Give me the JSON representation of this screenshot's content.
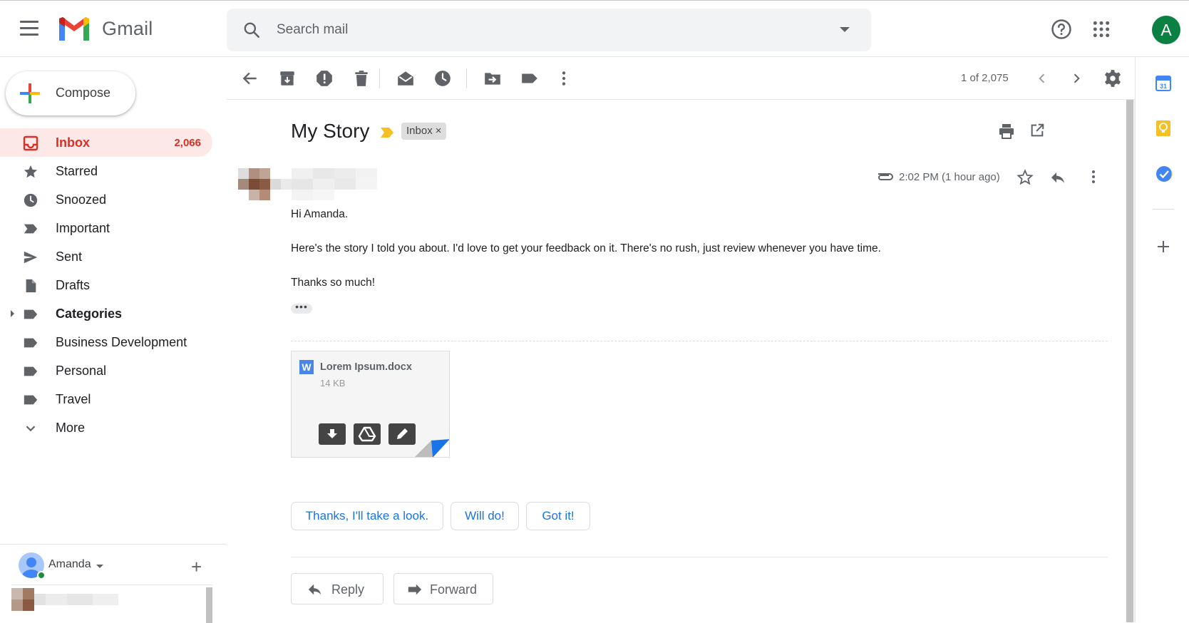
{
  "header": {
    "brand": "Gmail",
    "search_placeholder": "Search mail",
    "account_initial": "A"
  },
  "sidebar": {
    "compose_label": "Compose",
    "items": [
      {
        "label": "Inbox",
        "count": "2,066"
      },
      {
        "label": "Starred"
      },
      {
        "label": "Snoozed"
      },
      {
        "label": "Important"
      },
      {
        "label": "Sent"
      },
      {
        "label": "Drafts"
      },
      {
        "label": "Categories"
      },
      {
        "label": "Business Development"
      },
      {
        "label": "Personal"
      },
      {
        "label": "Travel"
      },
      {
        "label": "More"
      }
    ],
    "hangouts_user": "Amanda"
  },
  "toolbar": {
    "pager": "1 of 2,075"
  },
  "message": {
    "subject": "My Story",
    "label_chip": "Inbox",
    "time": "2:02 PM (1 hour ago)",
    "greeting": "Hi Amanda.",
    "body": "Here's the story I told you about. I'd love to get your feedback on it. There's no rush, just review whenever you have time.",
    "closing": "Thanks so much!",
    "attachment": {
      "name": "Lorem Ipsum.docx",
      "size": "14 KB",
      "icon_letter": "W"
    },
    "smart_replies": [
      "Thanks, I'll take a look.",
      "Will do!",
      "Got it!"
    ],
    "reply_label": "Reply",
    "forward_label": "Forward"
  },
  "colors": {
    "accent_red": "#d93025",
    "link_blue": "#1a73e8",
    "active_bg": "#fce8e6"
  }
}
